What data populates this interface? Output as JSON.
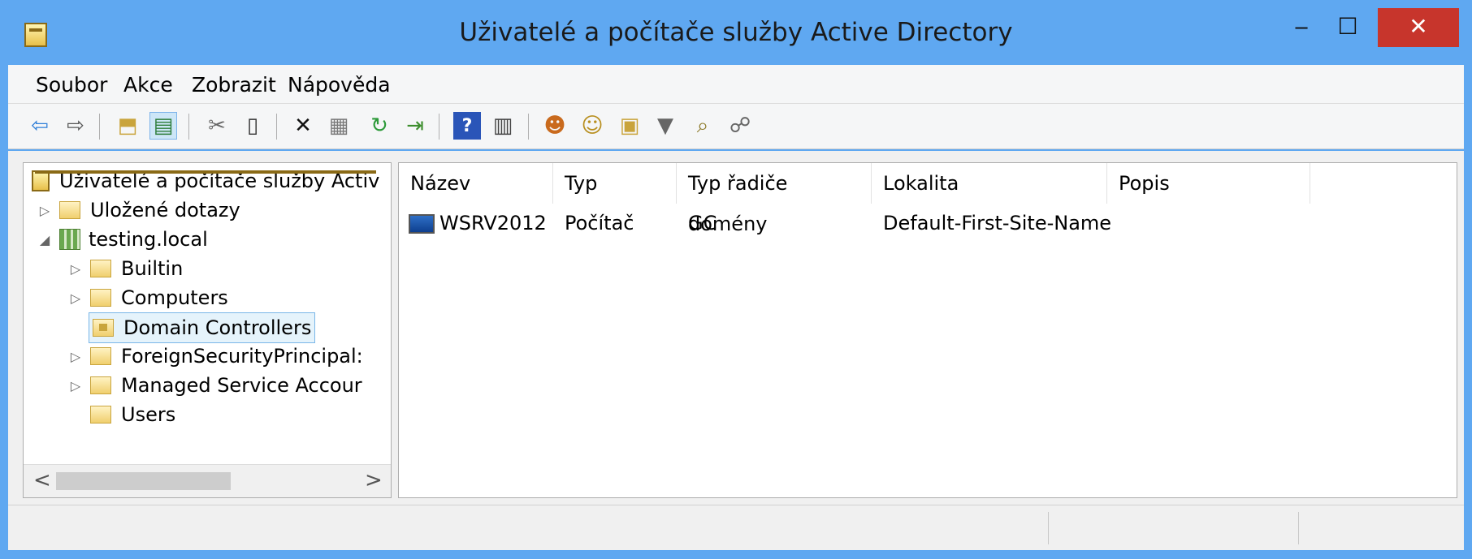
{
  "window": {
    "title": "Uživatelé a počítače služby Active Directory",
    "controls": {
      "minimize": "‒",
      "maximize": "☐",
      "close": "✕"
    }
  },
  "menu": [
    "Soubor",
    "Akce",
    "Zobrazit",
    "Nápověda"
  ],
  "toolbar": {
    "icons": [
      "back-icon",
      "forward-icon",
      "up-folder-icon",
      "show-console-tree-icon",
      "cut-icon",
      "paste-icon",
      "delete-icon",
      "properties-icon",
      "refresh-icon",
      "export-list-icon",
      "help-icon",
      "action-pane-icon",
      "new-user-icon",
      "new-group-icon",
      "new-ou-icon",
      "filter-icon",
      "find-icon",
      "add-to-group-icon"
    ]
  },
  "tree": {
    "root": "Uživatelé a počítače služby Activ",
    "saved_queries": "Uložené dotazy",
    "domain": "testing.local",
    "children": [
      "Builtin",
      "Computers",
      "Domain Controllers",
      "ForeignSecurityPrincipal:",
      "Managed Service Accour",
      "Users"
    ],
    "selected": "Domain Controllers",
    "scroll_left": "<",
    "scroll_right": ">"
  },
  "list": {
    "columns": [
      "Název",
      "Typ",
      "Typ řadiče domény",
      "Lokalita",
      "Popis"
    ],
    "rows": [
      {
        "name": "WSRV2012",
        "type": "Počítač",
        "dc_type": "GC",
        "site": "Default-First-Site-Name",
        "description": ""
      }
    ]
  },
  "colors": {
    "window_frame": "#5fa8f1",
    "close_button": "#c7352c",
    "selection_border": "#7ab6e8"
  }
}
